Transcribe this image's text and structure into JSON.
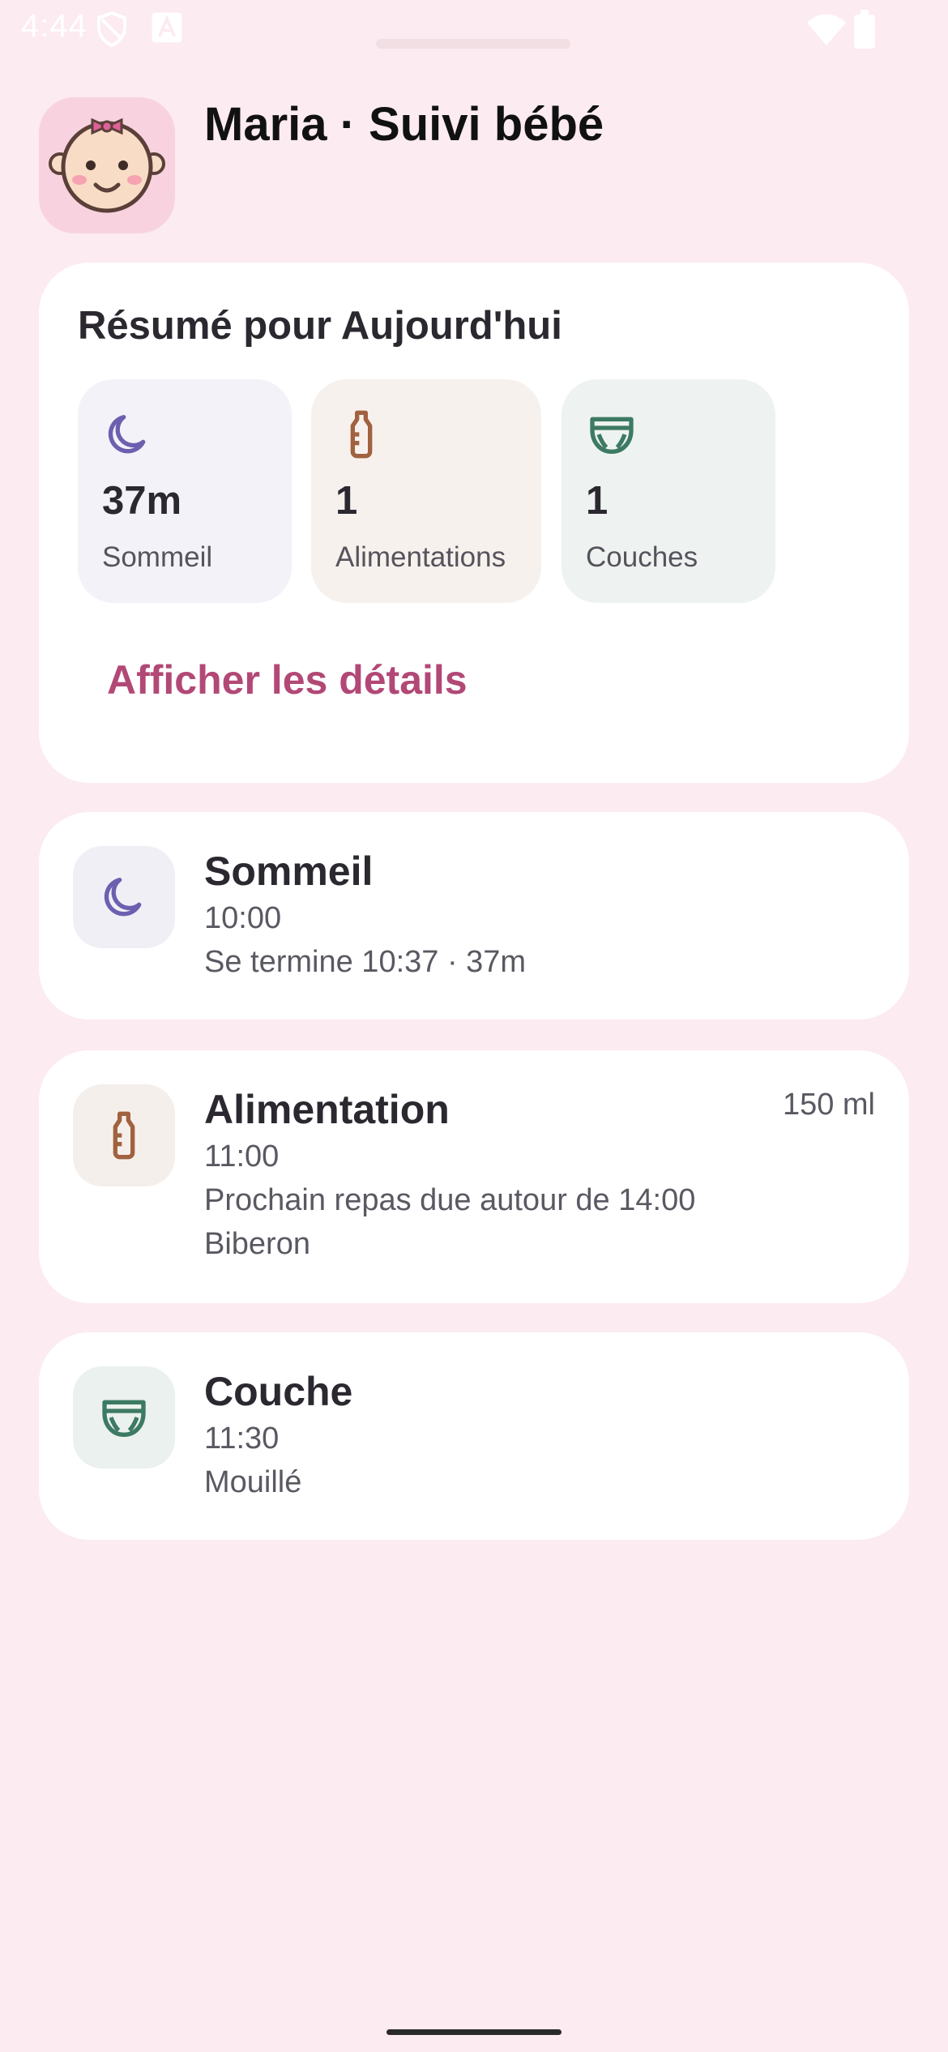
{
  "status_bar": {
    "time": "4:44",
    "icons": [
      "shield-icon",
      "font-a-icon",
      "wifi-icon",
      "battery-icon"
    ]
  },
  "header": {
    "title": "Maria · Suivi bébé",
    "avatar_icon": "baby-face-icon"
  },
  "summary": {
    "title": "Résumé pour Aujourd'hui",
    "tiles": [
      {
        "icon": "moon-icon",
        "value": "37m",
        "label": "Sommeil",
        "color": "#6d5fb0"
      },
      {
        "icon": "bottle-icon",
        "value": "1",
        "label": "Alimentations",
        "color": "#a1623f"
      },
      {
        "icon": "diaper-icon",
        "value": "1",
        "label": "Couches",
        "color": "#3d7a63"
      }
    ],
    "details_link": "Afficher les détails"
  },
  "events": {
    "sleep": {
      "title": "Sommeil",
      "time": "10:00",
      "detail": "Se termine 10:37 · 37m"
    },
    "feeding": {
      "title": "Alimentation",
      "amount": "150 ml",
      "time": "11:00",
      "detail": "Prochain repas due autour de 14:00",
      "method": "Biberon"
    },
    "diaper": {
      "title": "Couche",
      "time": "11:30",
      "detail": "Mouillé"
    }
  },
  "colors": {
    "background": "#fcebf0",
    "accent": "#b24876",
    "sleep": "#6d5fb0",
    "feeding": "#a1623f",
    "diaper": "#3d7a63"
  }
}
